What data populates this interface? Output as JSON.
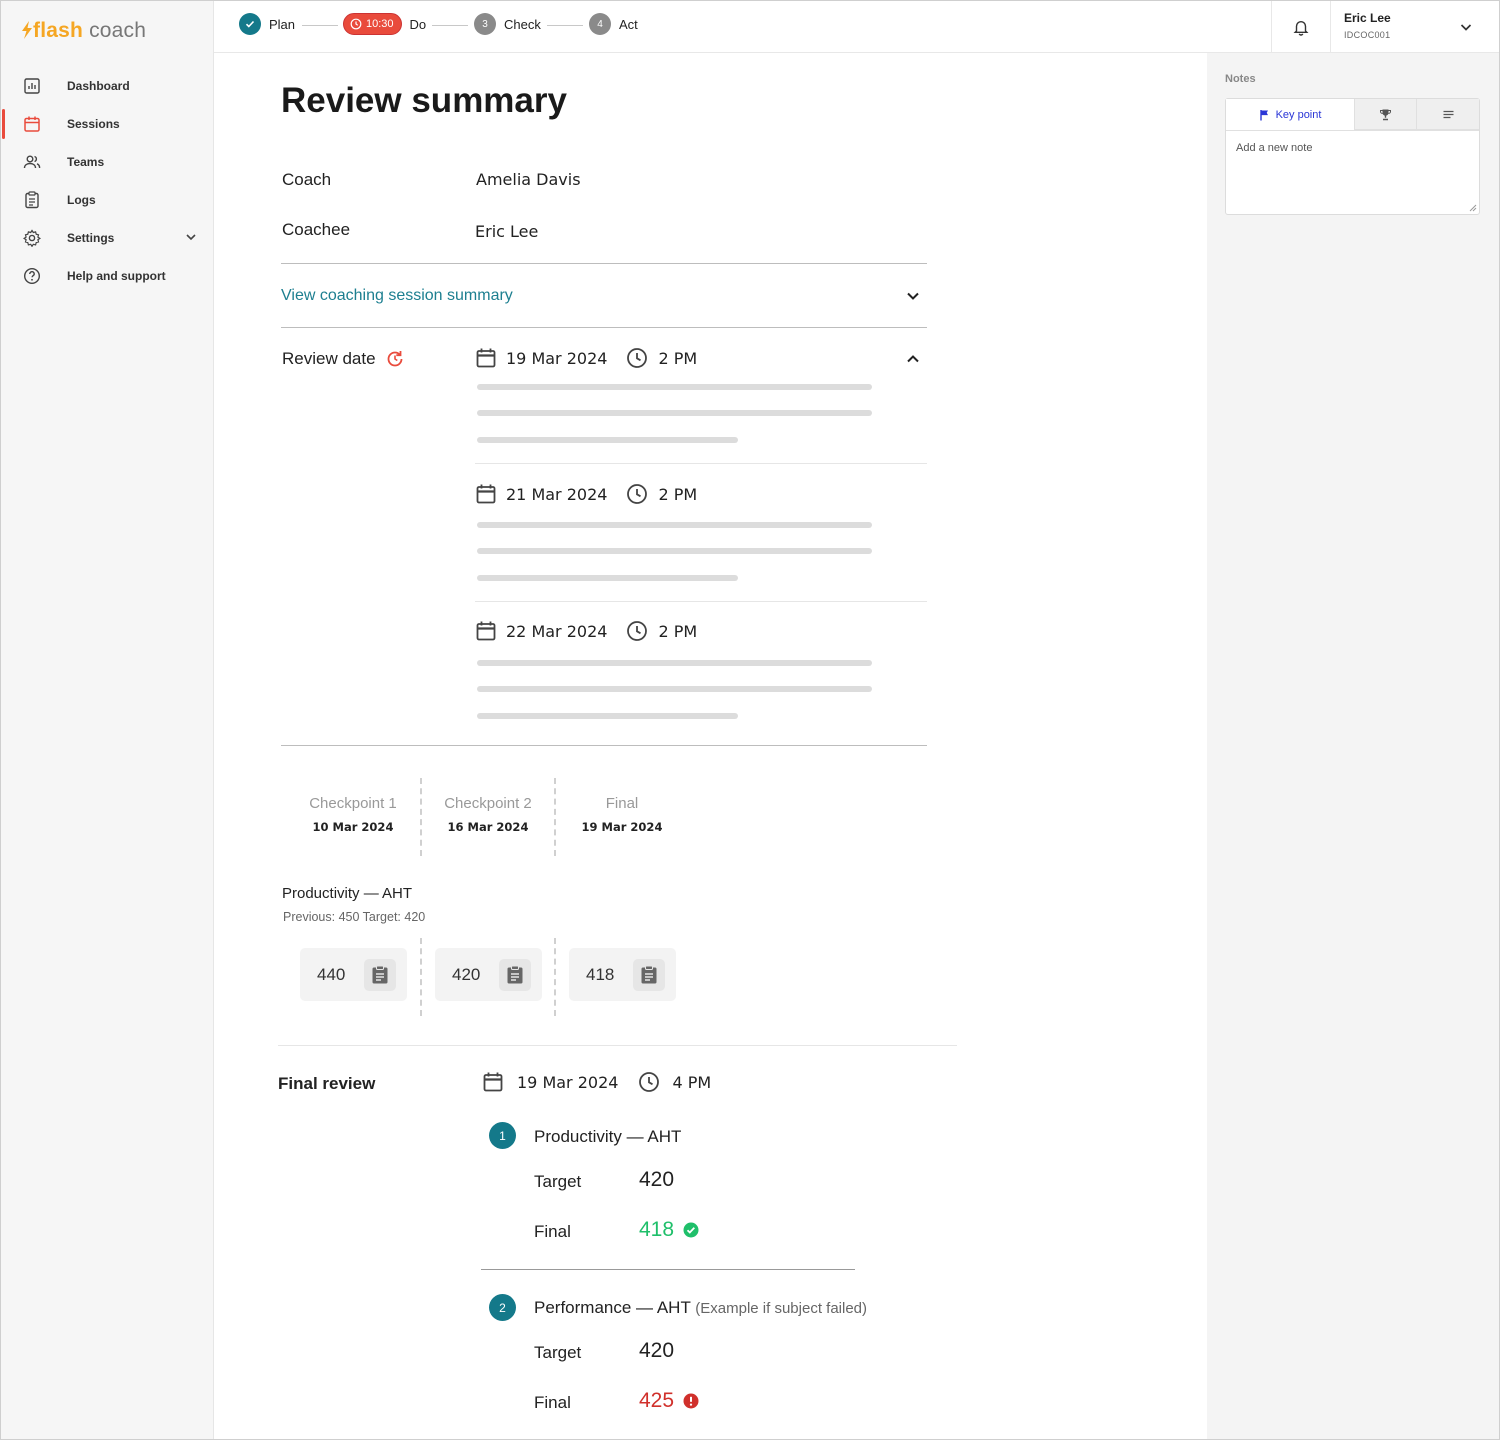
{
  "app": {
    "logo_flash": "flash",
    "logo_coach": "coach"
  },
  "sidebar": {
    "items": [
      {
        "label": "Dashboard",
        "icon": "bar-chart-icon"
      },
      {
        "label": "Sessions",
        "icon": "calendar-icon",
        "active": true
      },
      {
        "label": "Teams",
        "icon": "people-icon"
      },
      {
        "label": "Logs",
        "icon": "clipboard-list-icon"
      },
      {
        "label": "Settings",
        "icon": "gear-icon"
      },
      {
        "label": "Help and support",
        "icon": "help-circle-icon"
      }
    ]
  },
  "stepper": {
    "steps": [
      {
        "label": "Plan",
        "state": "done"
      },
      {
        "label": "Do",
        "state": "active",
        "timer": "10:30"
      },
      {
        "label": "Check",
        "number": "3"
      },
      {
        "label": "Act",
        "number": "4"
      }
    ]
  },
  "user": {
    "name": "Eric Lee",
    "id": "IDCOC001"
  },
  "notes": {
    "title": "Notes",
    "tab_key_point": "Key point",
    "placeholder": "Add a new note"
  },
  "main": {
    "title": "Review summary",
    "coach_label": "Coach",
    "coach_value": "Amelia Davis",
    "coachee_label": "Coachee",
    "coachee_value": "Eric Lee",
    "summary_link": "View coaching session summary",
    "review_date_label": "Review date",
    "review_dates": [
      {
        "date": "19 Mar 2024",
        "time": "2 PM"
      },
      {
        "date": "21 Mar 2024",
        "time": "2 PM"
      },
      {
        "date": "22 Mar 2024",
        "time": "2 PM"
      }
    ],
    "checkpoints": [
      {
        "label": "Checkpoint 1",
        "date": "10 Mar 2024"
      },
      {
        "label": "Checkpoint 2",
        "date": "16 Mar 2024"
      },
      {
        "label": "Final",
        "date": "19 Mar 2024"
      }
    ],
    "metric": {
      "title": "Productivity — AHT",
      "subtitle": "Previous: 450   Target: 420",
      "values": [
        "440",
        "420",
        "418"
      ]
    },
    "final_review": {
      "title": "Final review",
      "date": "19 Mar 2024",
      "time": "4 PM",
      "target_label": "Target",
      "final_label": "Final",
      "goals": [
        {
          "number": "1",
          "title": "Productivity — AHT",
          "note": "",
          "target": "420",
          "final": "418",
          "status": "pass",
          "status_color": "#1fbf6a"
        },
        {
          "number": "2",
          "title": "Performance — AHT",
          "note": "(Example if subject failed)",
          "target": "420",
          "final": "425",
          "status": "fail",
          "status_color": "#d0302b"
        }
      ]
    }
  },
  "colors": {
    "accent": "#14798a",
    "alert": "#e94b3c",
    "brand": "#f5a623",
    "link": "#1d7f90"
  }
}
